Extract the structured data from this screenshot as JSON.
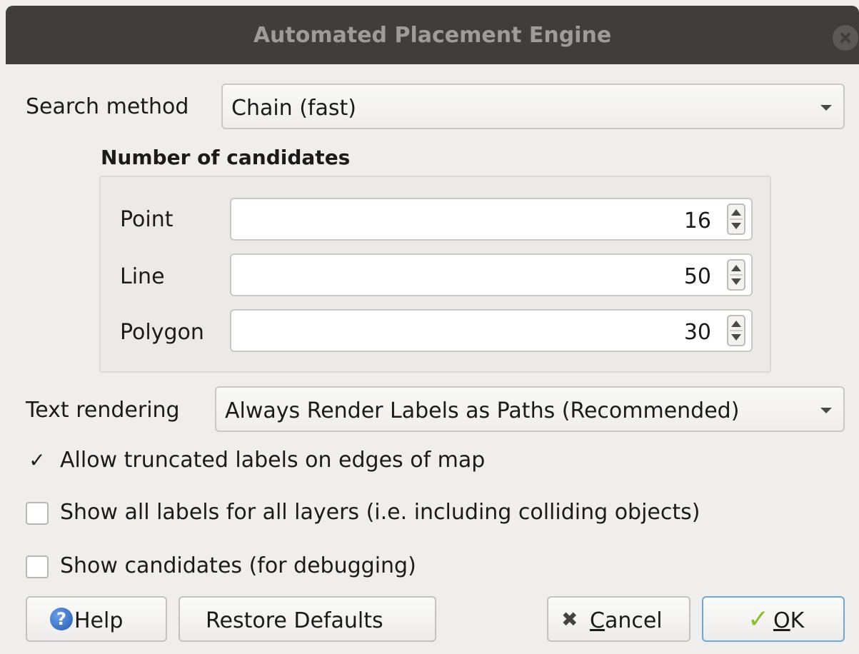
{
  "window": {
    "title": "Automated Placement Engine"
  },
  "search_method": {
    "label": "Search method",
    "value": "Chain (fast)"
  },
  "candidates": {
    "group_title": "Number of candidates",
    "point": {
      "label": "Point",
      "value": "16"
    },
    "line": {
      "label": "Line",
      "value": "50"
    },
    "polygon": {
      "label": "Polygon",
      "value": "30"
    }
  },
  "text_rendering": {
    "label": "Text rendering",
    "value": "Always Render Labels as Paths (Recommended)"
  },
  "options": {
    "truncated": {
      "label": "Allow truncated labels on edges of map",
      "checked": true,
      "mark": "✓"
    },
    "show_all": {
      "label": "Show all labels for all layers (i.e. including colliding objects)",
      "checked": false
    },
    "candidates": {
      "label": "Show candidates (for debugging)",
      "checked": false
    }
  },
  "buttons": {
    "help": {
      "icon": "help-icon",
      "glyph": "?",
      "label": "Help"
    },
    "restore": {
      "label": "Restore Defaults"
    },
    "cancel": {
      "icon": "cancel-icon",
      "glyph": "✖",
      "mnemonic": "C",
      "rest": "ancel"
    },
    "ok": {
      "icon": "check-icon",
      "glyph": "✓",
      "mnemonic": "O",
      "rest": "K"
    }
  },
  "colors": {
    "titlebar": "#3f3e3b",
    "dialog_bg": "#efeeec",
    "ok_border": "#6ea7d8",
    "ok_check": "#8bbf2e",
    "help_icon": "#2f6bc9"
  }
}
